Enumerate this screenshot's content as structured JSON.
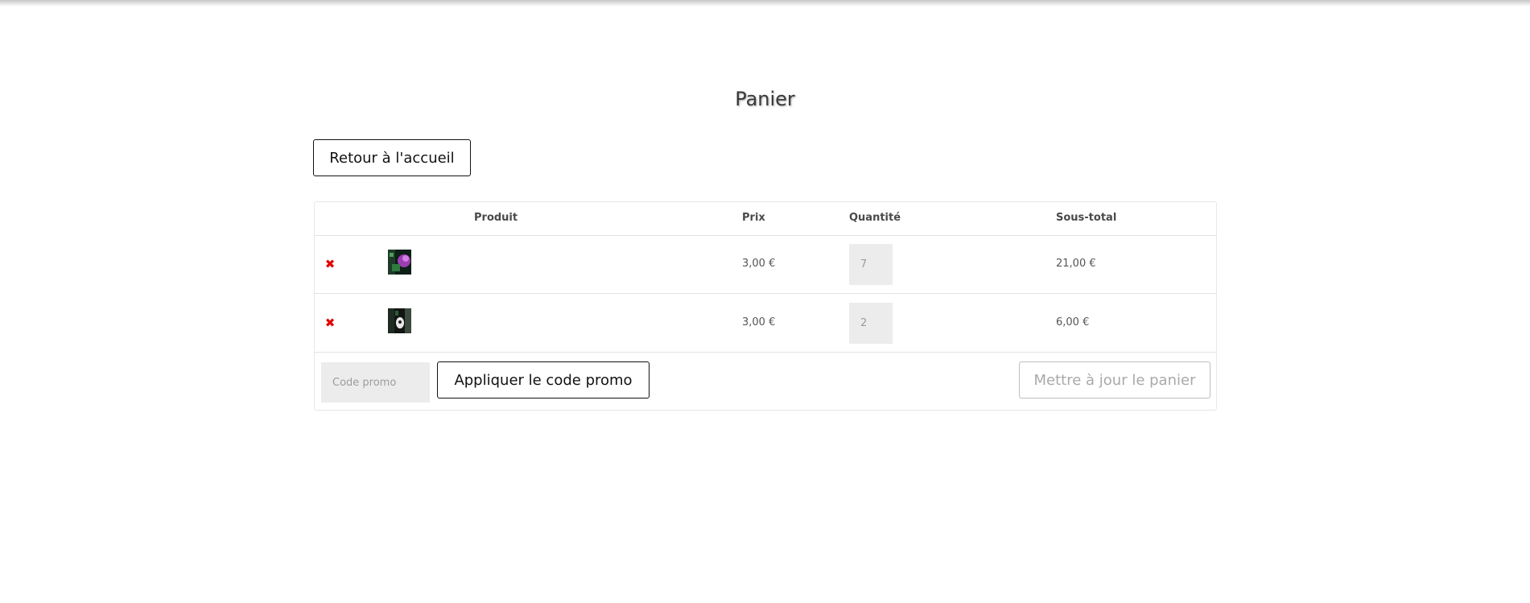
{
  "page": {
    "title": "Panier"
  },
  "nav": {
    "home_button": "Retour à l'accueil"
  },
  "cart": {
    "headers": {
      "product": "Produit",
      "price": "Prix",
      "quantity": "Quantité",
      "subtotal": "Sous-total"
    },
    "items": [
      {
        "remove_icon": "✖",
        "thumbnail": "product-thumbnail-purple",
        "price": "3,00 €",
        "quantity": "7",
        "subtotal": "21,00 €"
      },
      {
        "remove_icon": "✖",
        "thumbnail": "product-thumbnail-dark",
        "price": "3,00 €",
        "quantity": "2",
        "subtotal": "6,00 €"
      }
    ],
    "promo": {
      "placeholder": "Code promo",
      "apply_label": "Appliquer le code promo"
    },
    "update_label": "Mettre à jour le panier"
  },
  "colors": {
    "remove": "#e00000",
    "input_bg": "#ececec",
    "border": "#e2e2e2"
  }
}
